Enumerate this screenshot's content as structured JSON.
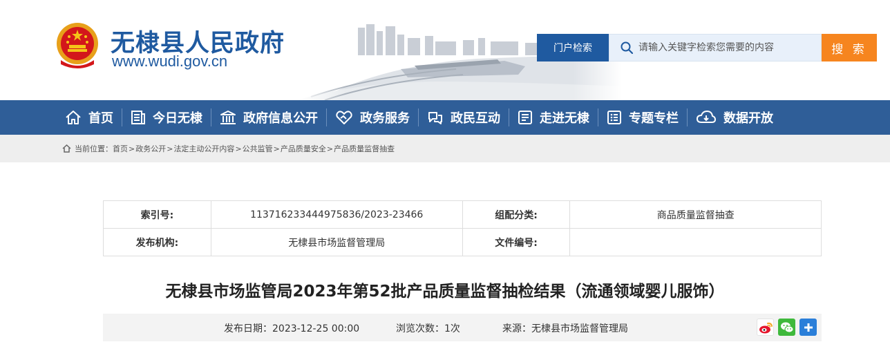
{
  "header": {
    "site_title": "无棣县人民政府",
    "site_url": "www.wudi.gov.cn",
    "emblem_icon": "national-emblem-icon"
  },
  "search": {
    "portal_label": "门户检索",
    "placeholder": "请输入关键字检索您需要的内容",
    "button_label": "搜 索"
  },
  "nav": {
    "items": [
      {
        "label": "首页",
        "icon": "home-icon"
      },
      {
        "label": "今日无棣",
        "icon": "news-icon"
      },
      {
        "label": "政府信息公开",
        "icon": "building-icon"
      },
      {
        "label": "政务服务",
        "icon": "handshake-icon"
      },
      {
        "label": "政民互动",
        "icon": "chat-icon"
      },
      {
        "label": "走进无棣",
        "icon": "document-icon"
      },
      {
        "label": "专题专栏",
        "icon": "list-icon"
      },
      {
        "label": "数据开放",
        "icon": "cloud-download-icon"
      }
    ]
  },
  "breadcrumb": {
    "prefix": "当前位置：",
    "items": [
      "首页",
      "政务公开",
      "法定主动公开内容",
      "公共监管",
      "产品质量安全",
      "产品质量监督抽查"
    ],
    "separator": ">"
  },
  "info_table": {
    "index_label": "索引号:",
    "index_value": "113716233444975836/2023-23466",
    "category_label": "组配分类:",
    "category_value": "商品质量监督抽查",
    "publisher_label": "发布机构:",
    "publisher_value": "无棣县市场监督管理局",
    "docno_label": "文件编号:",
    "docno_value": ""
  },
  "article": {
    "title": "无棣县市场监管局2023年第52批产品质量监督抽检结果（流通领域婴儿服饰）",
    "date_label": "发布日期：",
    "date_value": "2023-12-25 00:00",
    "views_label": "浏览次数：",
    "views_value": "1次",
    "source_label": "来源：",
    "source_value": "无棣县市场监督管理局"
  },
  "share": {
    "icons": [
      "weibo-icon",
      "wechat-icon",
      "more-share-icon"
    ]
  },
  "colors": {
    "brand_blue": "#1f5aa0",
    "nav_blue": "#2f5e98",
    "search_orange": "#f6851f"
  }
}
